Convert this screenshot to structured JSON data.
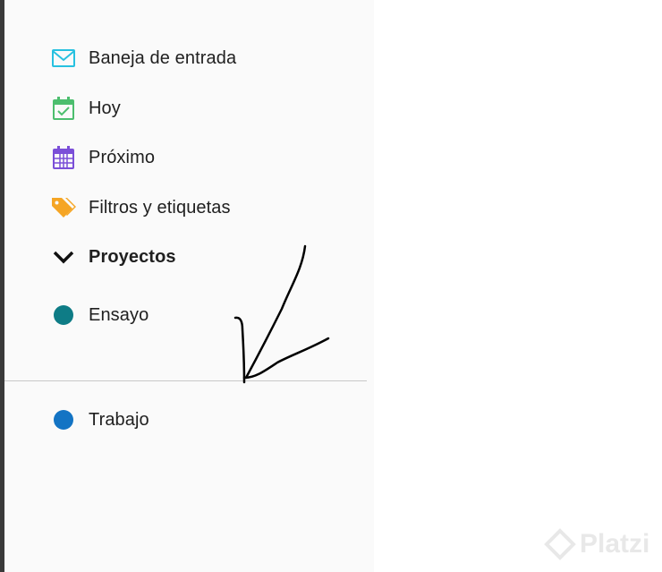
{
  "sidebar": {
    "items": [
      {
        "label": "Baneja de entrada",
        "icon": "inbox-icon",
        "color": "#27c1e0"
      },
      {
        "label": "Hoy",
        "icon": "calendar-check-icon",
        "color": "#4cbe6e"
      },
      {
        "label": "Próximo",
        "icon": "calendar-grid-icon",
        "color": "#7b4fd8"
      },
      {
        "label": "Filtros y etiquetas",
        "icon": "tag-icon",
        "color": "#f5a524"
      }
    ],
    "projects_header": {
      "label": "Proyectos",
      "icon": "chevron-down-icon"
    },
    "projects": [
      {
        "label": "Ensayo",
        "color": "#0e7c86"
      },
      {
        "label": "Trabajo",
        "color": "#1374c4"
      }
    ]
  },
  "watermark": {
    "text": "Platzi"
  }
}
